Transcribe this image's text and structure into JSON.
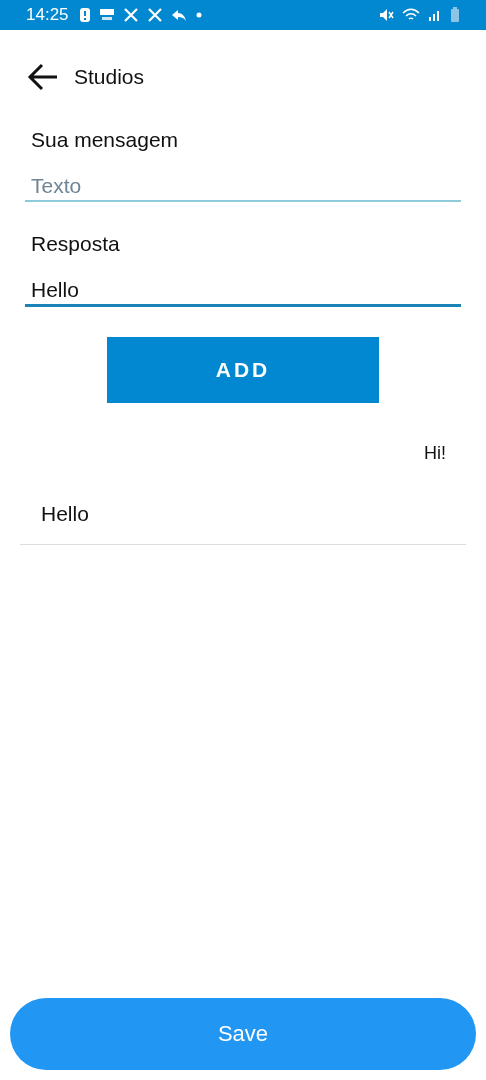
{
  "status_bar": {
    "time": "14:25"
  },
  "header": {
    "title": "Studios"
  },
  "fields": [
    {
      "label": "Sua mensagem",
      "placeholder": "Texto",
      "focused": false
    },
    {
      "label": "Resposta",
      "value": "Hello",
      "focused": true
    }
  ],
  "add_button": "ADD",
  "messages": [
    {
      "kind": "sent",
      "text": "Hi!"
    },
    {
      "kind": "received",
      "text": "Hello"
    }
  ],
  "save_button": "Save"
}
